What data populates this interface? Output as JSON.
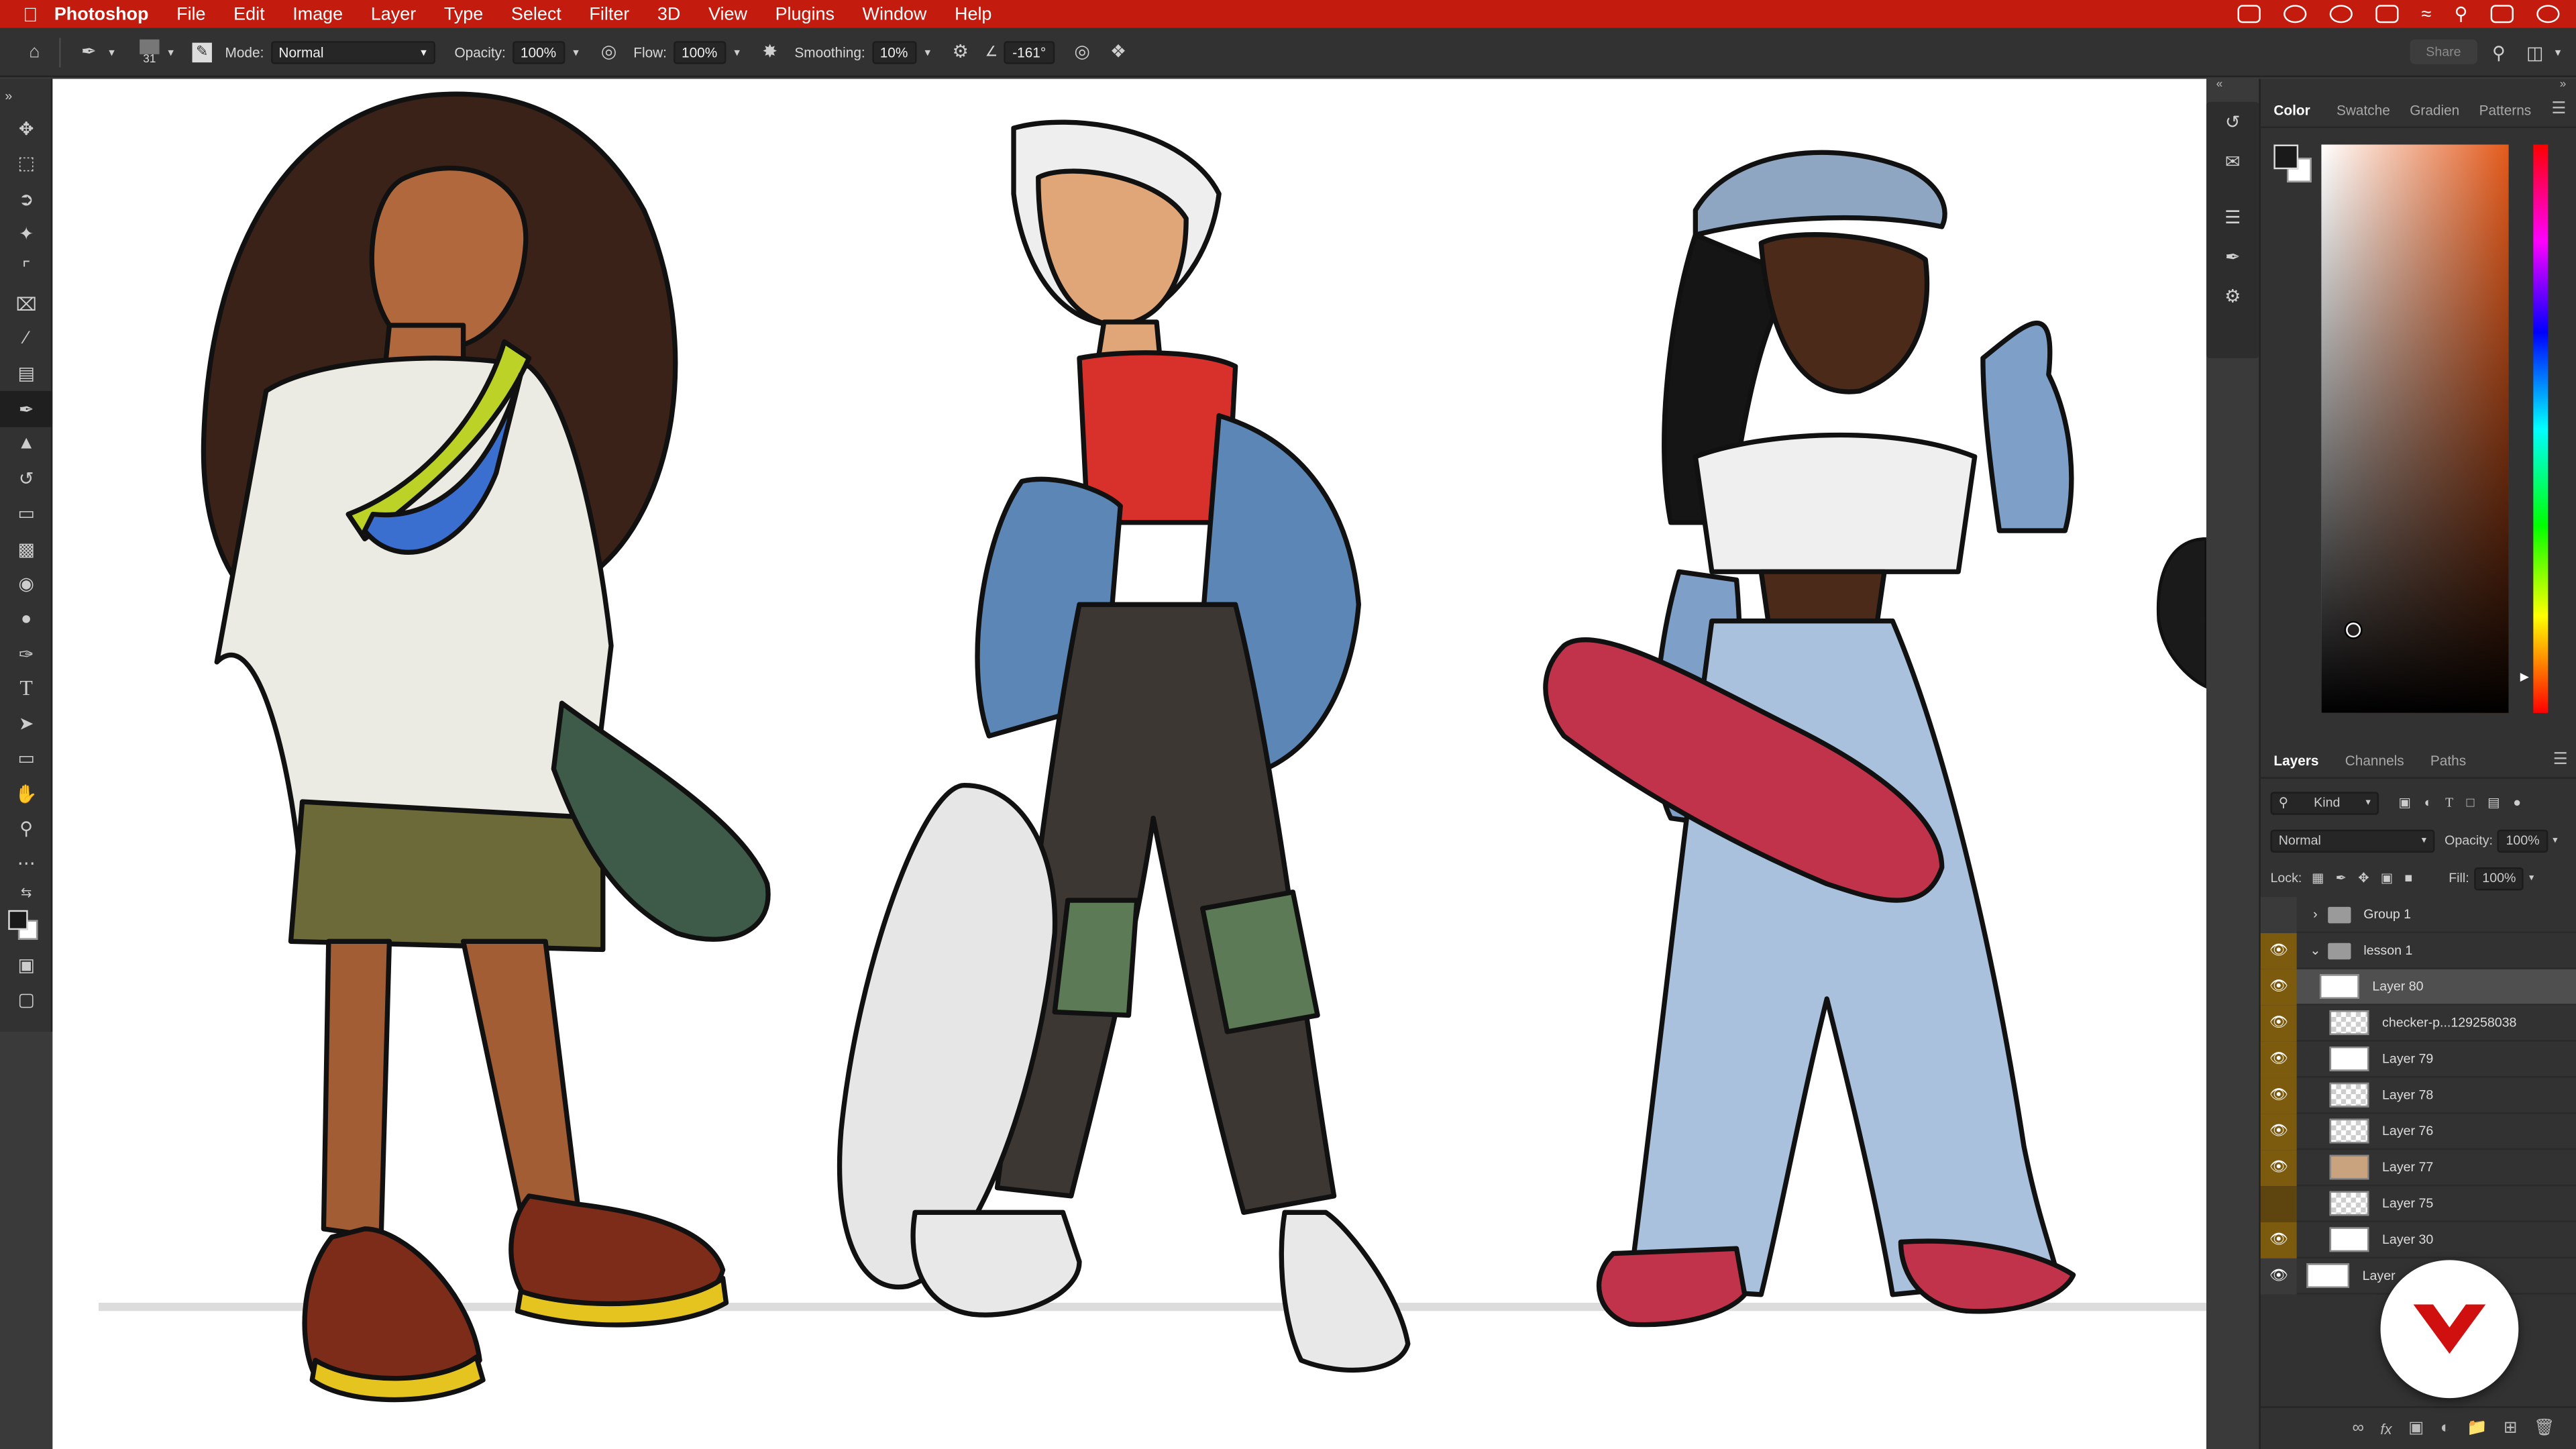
{
  "menubar": {
    "apple_icon": "apple-icon",
    "app_name": "Photoshop",
    "items": [
      "File",
      "Edit",
      "Image",
      "Layer",
      "Type",
      "Select",
      "Filter",
      "3D",
      "View",
      "Plugins",
      "Window",
      "Help"
    ]
  },
  "options": {
    "brush_size": "31",
    "mode_label": "Mode:",
    "mode_value": "Normal",
    "opacity_label": "Opacity:",
    "opacity_value": "100%",
    "flow_label": "Flow:",
    "flow_value": "100%",
    "smoothing_label": "Smoothing:",
    "smoothing_value": "10%",
    "angle_value": "-161°",
    "share_label": "Share"
  },
  "color_panel": {
    "tabs": [
      "Color",
      "Swatche",
      "Gradien",
      "Patterns"
    ],
    "foreground": "#1a1a1a",
    "background": "#ffffff",
    "hue_color": "#e35a1c"
  },
  "layers_panel": {
    "tabs": [
      "Layers",
      "Channels",
      "Paths"
    ],
    "filter_value": "Kind",
    "blend_value": "Normal",
    "opacity_label": "Opacity:",
    "opacity_value": "100%",
    "lock_label": "Lock:",
    "fill_label": "Fill:",
    "fill_value": "100%",
    "rows": [
      {
        "name": "Group 1",
        "type": "group",
        "visible": false,
        "expanded": false
      },
      {
        "name": "lesson 1",
        "type": "group",
        "visible": true,
        "expanded": true
      },
      {
        "name": "Layer 80",
        "type": "layer",
        "visible": true,
        "selected": true
      },
      {
        "name": "checker-p...129258038",
        "type": "layer",
        "visible": true
      },
      {
        "name": "Layer 79",
        "type": "layer",
        "visible": true
      },
      {
        "name": "Layer 78",
        "type": "layer",
        "visible": true
      },
      {
        "name": "Layer 76",
        "type": "layer",
        "visible": true
      },
      {
        "name": "Layer 77",
        "type": "layer",
        "visible": true
      },
      {
        "name": "Layer 75",
        "type": "layer",
        "visible": false
      },
      {
        "name": "Layer 30",
        "type": "layer",
        "visible": true
      },
      {
        "name": "Layer",
        "type": "layer",
        "visible": true
      }
    ]
  },
  "colors": {
    "menubar": "#c41b0f",
    "eye_column": "#7c5a0e",
    "badge_mark": "#d0100f"
  }
}
